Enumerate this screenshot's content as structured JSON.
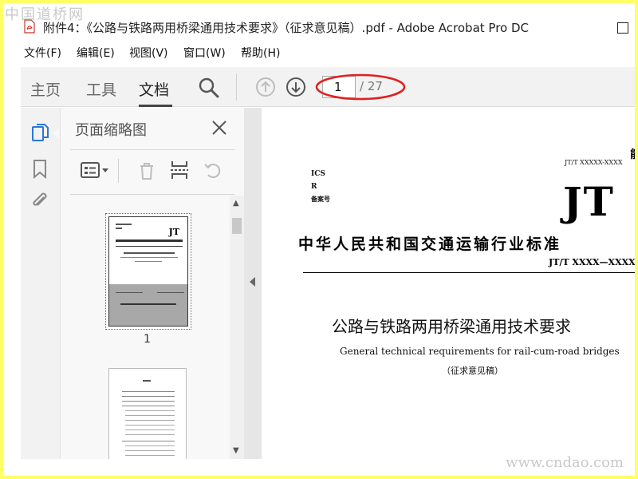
{
  "watermark": {
    "top": "中国道桥网",
    "bottom": "www.cndao.com"
  },
  "window": {
    "title": "附件4：《公路与铁路两用桥梁通用技术要求》（征求意见稿）.pdf - Adobe Acrobat Pro DC"
  },
  "menu": [
    "文件(F)",
    "编辑(E)",
    "视图(V)",
    "窗口(W)",
    "帮助(H)"
  ],
  "toolbar": {
    "tabs": [
      {
        "label": "主页"
      },
      {
        "label": "工具"
      },
      {
        "label": "文档",
        "active": true
      }
    ],
    "page_current": "1",
    "page_total": "/ 27",
    "annotation_color": "#e02020"
  },
  "sidebar": {
    "panel_title": "页面缩略图",
    "thumbnails": [
      {
        "label": "1"
      }
    ]
  },
  "document": {
    "code_top": "JT/T XXXXX-XXXX",
    "ics": "ICS",
    "r": "R",
    "beian": "备案号",
    "jt": "JT",
    "org": "中华人民共和国交通运输行业标准",
    "std_no": "JT/T XXXX—XXXX",
    "title": "公路与铁路两用桥梁通用技术要求",
    "title_en": "General technical requirements for rail-cum-road bridges",
    "draft": "（征求意见稿）"
  }
}
